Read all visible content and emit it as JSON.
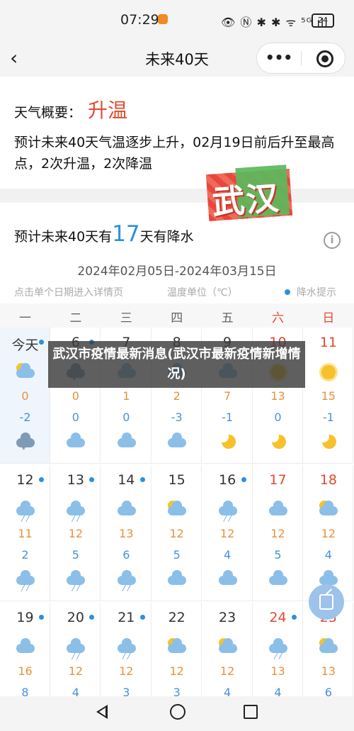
{
  "status_bar": {
    "time": "07:29",
    "right_icons": "👁 Ⓝ ✱ ✱ ᯤ ⁵ᴳ ıll",
    "battery": "24"
  },
  "nav": {
    "title": "未来40天",
    "back_icon": "‹",
    "more_icon": "•••",
    "close_icon": "target-icon"
  },
  "summary": {
    "label": "天气概要：",
    "trend": "升温",
    "description": "预计未来40天气温逐步上升，02月19日前后升至最高点，2次升温，2次降温"
  },
  "city_stamp": "武汉",
  "precip": {
    "prefix": "预计未来40天有",
    "days": "17",
    "suffix": "天有降水"
  },
  "date_range": "2024年02月05日-2024年03月15日",
  "hints": {
    "detail": "点击单个日期进入详情页",
    "unit": "温度单位（℃）",
    "rain": "降水提示"
  },
  "weekdays": [
    "一",
    "二",
    "三",
    "四",
    "五",
    "六",
    "日"
  ],
  "weeks": [
    [
      {
        "day": "今天",
        "hi": "0",
        "lo": "-2",
        "icon": "sun-cloud",
        "night": "cloud-snow",
        "rain": true,
        "today": true
      },
      {
        "day": "6",
        "hi": "0",
        "lo": "0",
        "icon": "cloud-snow",
        "night": "cloud",
        "rain": true
      },
      {
        "day": "7",
        "hi": "1",
        "lo": "0",
        "icon": "cloud",
        "night": "cloud",
        "rain": false
      },
      {
        "day": "8",
        "hi": "2",
        "lo": "-3",
        "icon": "cloud",
        "night": "cloud",
        "rain": false
      },
      {
        "day": "9",
        "hi": "7",
        "lo": "-1",
        "icon": "cloud",
        "night": "moon",
        "rain": false
      },
      {
        "day": "10",
        "hi": "13",
        "lo": "0",
        "icon": "sun",
        "night": "moon",
        "rain": false
      },
      {
        "day": "11",
        "hi": "15",
        "lo": "-1",
        "icon": "sun",
        "night": "moon",
        "rain": false
      }
    ],
    [
      {
        "day": "12",
        "hi": "11",
        "lo": "2",
        "icon": "cloud-rain",
        "night": "cloud-rain",
        "rain": true
      },
      {
        "day": "13",
        "hi": "12",
        "lo": "5",
        "icon": "cloud-rain",
        "night": "cloud-rain",
        "rain": true
      },
      {
        "day": "14",
        "hi": "13",
        "lo": "6",
        "icon": "cloud",
        "night": "cloud-rain",
        "rain": true
      },
      {
        "day": "15",
        "hi": "12",
        "lo": "5",
        "icon": "sun-cloud",
        "night": "cloud",
        "rain": false
      },
      {
        "day": "16",
        "hi": "12",
        "lo": "4",
        "icon": "cloud-rain",
        "night": "cloud",
        "rain": true
      },
      {
        "day": "17",
        "hi": "12",
        "lo": "5",
        "icon": "cloud",
        "night": "cloud",
        "rain": false
      },
      {
        "day": "18",
        "hi": "12",
        "lo": "4",
        "icon": "sun-cloud",
        "night": "cloud",
        "rain": false
      }
    ],
    [
      {
        "day": "19",
        "hi": "16",
        "lo": "8",
        "icon": "cloud",
        "night": "cloud",
        "rain": true
      },
      {
        "day": "20",
        "hi": "12",
        "lo": "4",
        "icon": "cloud-rain",
        "night": "cloud",
        "rain": true
      },
      {
        "day": "21",
        "hi": "12",
        "lo": "3",
        "icon": "cloud-rain",
        "night": "cloud",
        "rain": true
      },
      {
        "day": "22",
        "hi": "12",
        "lo": "3",
        "icon": "sun-cloud",
        "night": "cloud",
        "rain": false
      },
      {
        "day": "23",
        "hi": "12",
        "lo": "4",
        "icon": "sun-cloud",
        "night": "cloud",
        "rain": false
      },
      {
        "day": "24",
        "hi": "13",
        "lo": "4",
        "icon": "cloud-rain",
        "night": "cloud",
        "rain": true
      },
      {
        "day": "25",
        "hi": "13",
        "lo": "6",
        "icon": "sun-cloud",
        "night": "cloud",
        "rain": false
      }
    ]
  ],
  "news_banner": "武汉市疫情最新消息(武汉市最新疫情新增情况)",
  "colors": {
    "accent_blue": "#2d8fe0",
    "trend_red": "#e24a2c",
    "hi_orange": "#e8913a",
    "lo_blue": "#4a90d9"
  },
  "sys_nav": {
    "back": "back-icon",
    "home": "home-icon",
    "recent": "recent-apps-icon"
  }
}
